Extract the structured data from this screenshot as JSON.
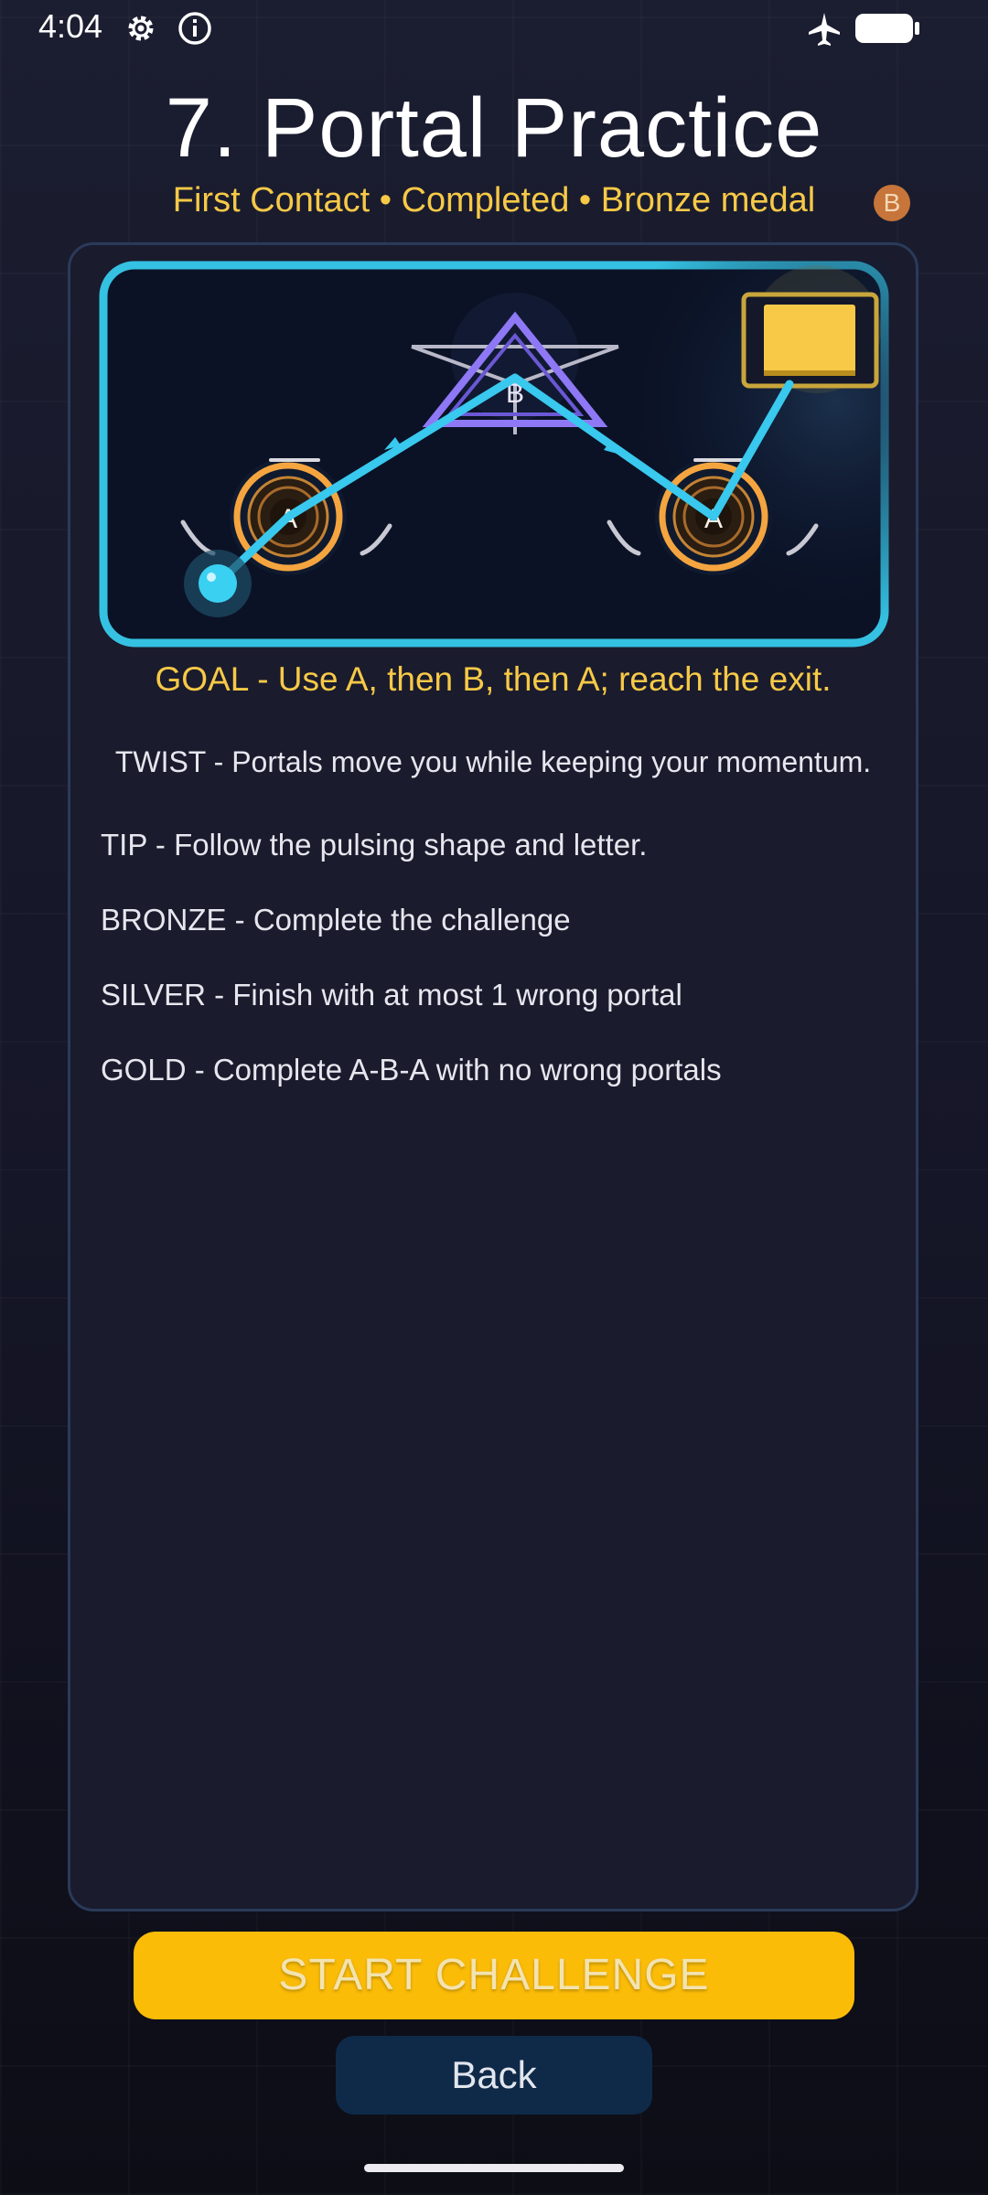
{
  "status_bar": {
    "time": "4:04",
    "icons": [
      "gear-icon",
      "info-icon",
      "airplane-icon",
      "battery-icon"
    ]
  },
  "header": {
    "title": "7. Portal Practice",
    "subtitle": "First Contact • Completed • Bronze medal",
    "medal_letter": "B"
  },
  "scene": {
    "portal_a_label": "A",
    "portal_b_label": "B",
    "colors": {
      "frame": "#35c1e2",
      "path": "#39c8ee",
      "portal_a": "#f5a53f",
      "portal_b": "#8e78f5",
      "exit": "#f7c947"
    }
  },
  "challenge": {
    "goal": "GOAL - Use A, then B, then A; reach the exit.",
    "twist": "TWIST - Portals move you while keeping your momentum.",
    "tip": "TIP - Follow the pulsing shape and letter.",
    "bronze": "BRONZE - Complete the challenge",
    "silver": "SILVER - Finish with at most 1 wrong portal",
    "gold": "GOLD - Complete A-B-A with no wrong portals"
  },
  "buttons": {
    "start": "START CHALLENGE",
    "back": "Back"
  },
  "colors": {
    "accent_yellow": "#fbbc08",
    "gold_text": "#f7c947",
    "back_button": "#0f2a48"
  }
}
